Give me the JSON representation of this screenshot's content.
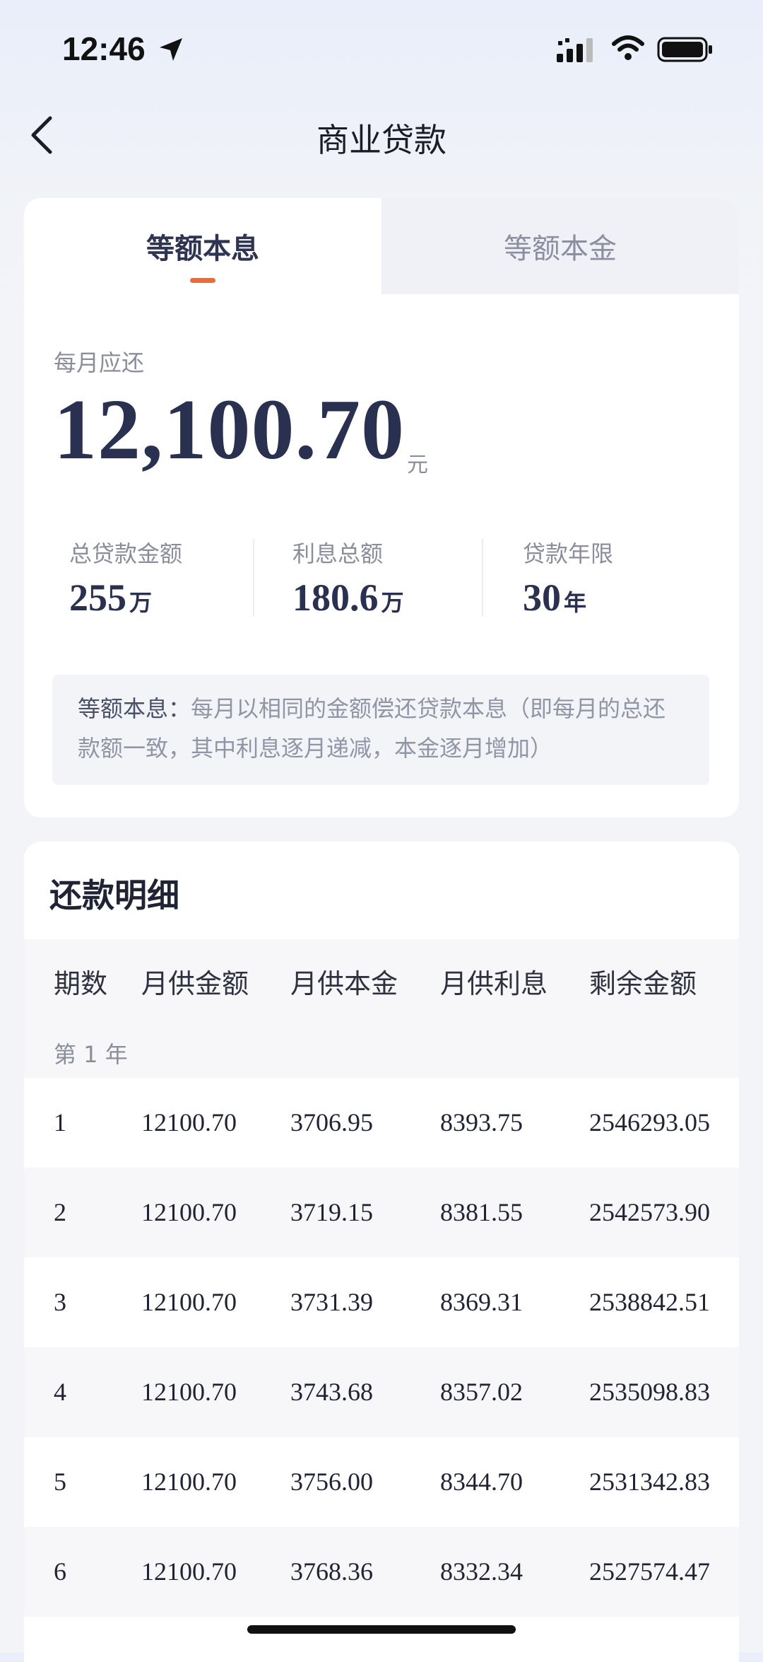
{
  "status_bar": {
    "time": "12:46"
  },
  "nav": {
    "title": "商业贷款"
  },
  "tabs": [
    {
      "label": "等额本息",
      "active": true
    },
    {
      "label": "等额本金",
      "active": false
    }
  ],
  "summary": {
    "monthly_label": "每月应还",
    "monthly_amount": "12,100.70",
    "monthly_unit": "元",
    "stats": [
      {
        "label": "总贷款金额",
        "value": "255",
        "unit": "万"
      },
      {
        "label": "利息总额",
        "value": "180.6",
        "unit": "万"
      },
      {
        "label": "贷款年限",
        "value": "30",
        "unit": "年"
      }
    ],
    "note_keyword": "等额本息：",
    "note_text": "每月以相同的金额偿还贷款本息（即每月的总还款额一致，其中利息逐月递减，本金逐月增加）"
  },
  "details": {
    "title": "还款明细",
    "headers": [
      "期数",
      "月供金额",
      "月供本金",
      "月供利息",
      "剩余金额"
    ],
    "year_label": "第 1 年",
    "rows": [
      [
        "1",
        "12100.70",
        "3706.95",
        "8393.75",
        "2546293.05"
      ],
      [
        "2",
        "12100.70",
        "3719.15",
        "8381.55",
        "2542573.90"
      ],
      [
        "3",
        "12100.70",
        "3731.39",
        "8369.31",
        "2538842.51"
      ],
      [
        "4",
        "12100.70",
        "3743.68",
        "8357.02",
        "2535098.83"
      ],
      [
        "5",
        "12100.70",
        "3756.00",
        "8344.70",
        "2531342.83"
      ],
      [
        "6",
        "12100.70",
        "3768.36",
        "8332.34",
        "2527574.47"
      ]
    ]
  },
  "colors": {
    "accent": "#f06a36",
    "primary_text": "#2a3050",
    "muted_text": "#8a8e9b"
  }
}
